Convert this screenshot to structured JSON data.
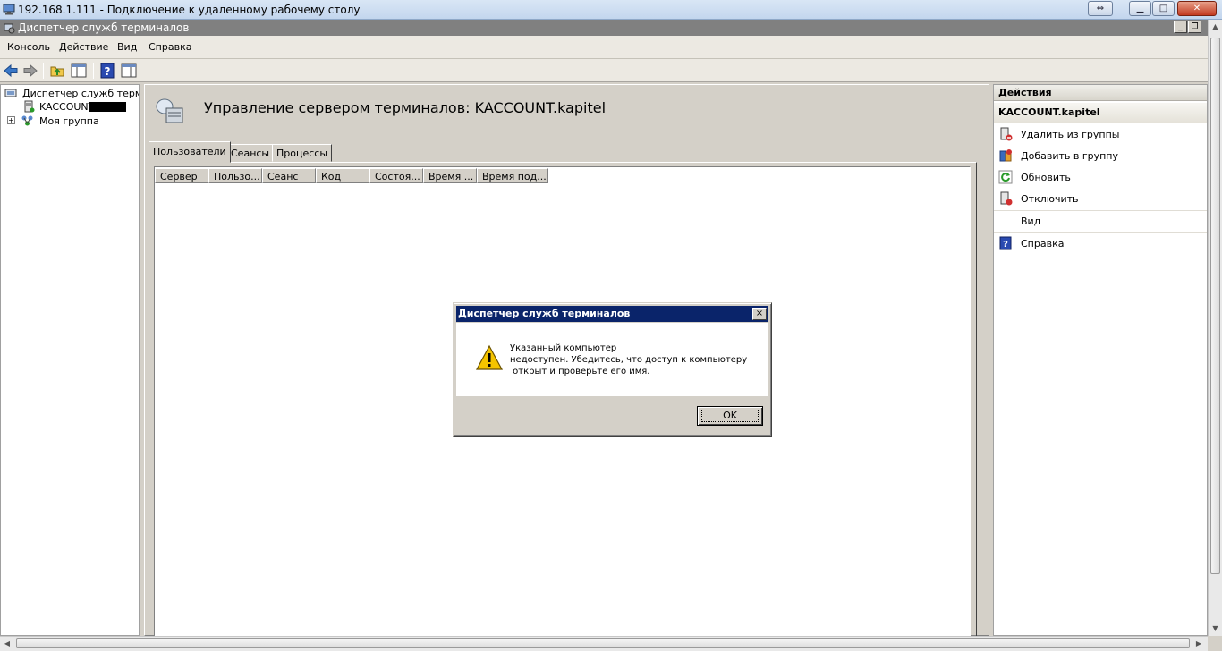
{
  "rdp": {
    "title": "192.168.1.111 - Подключение к удаленному рабочему столу"
  },
  "window": {
    "title": "Диспетчер служб терминалов"
  },
  "menu": [
    "Консоль",
    "Действие",
    "Вид",
    "Справка"
  ],
  "tree": {
    "root": "Диспетчер служб термин",
    "server": "KACCOUNT.",
    "group": "Моя группа",
    "expander": "+"
  },
  "center": {
    "title": "Управление сервером терминалов: KACCOUNT.kapitel",
    "tabs": [
      "Пользователи",
      "Сеансы",
      "Процессы"
    ],
    "columns": [
      "Сервер",
      "Пользо...",
      "Сеанс",
      "Код",
      "Состоя...",
      "Время ...",
      "Время под..."
    ]
  },
  "actions": {
    "header": "Действия",
    "subheader": "KACCOUNT.kapitel",
    "items": [
      "Удалить из группы",
      "Добавить в группу",
      "Обновить",
      "Отключить",
      "Вид",
      "Справка"
    ]
  },
  "dialog": {
    "title": "Диспетчер служб терминалов",
    "message": "Указанный компьютер\nнедоступен. Убедитесь, что доступ к компьютеру\n открыт и проверьте его имя.",
    "ok": "OK",
    "close": "×"
  },
  "colors": {
    "dialog_titlebar": "#0a246a",
    "inner_titlebar": "#808080",
    "chrome": "#d4d0c8"
  },
  "icons": {
    "rdp": "remote-desktop-icon",
    "app": "terminal-services-manager-icon",
    "warning": "warning-triangle-icon"
  }
}
